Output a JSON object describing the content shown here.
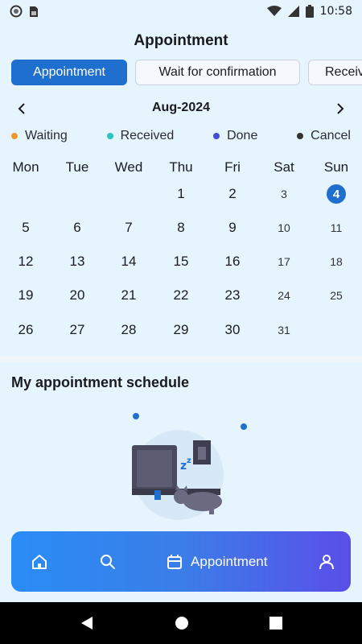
{
  "status_bar": {
    "time": "10:58"
  },
  "header": {
    "title": "Appointment"
  },
  "tabs": [
    {
      "label": "Appointment",
      "active": true
    },
    {
      "label": "Wait for confirmation",
      "active": false
    },
    {
      "label": "Receiv",
      "active": false
    }
  ],
  "calendar": {
    "month_label": "Aug-2024",
    "legend": [
      {
        "label": "Waiting",
        "color": "#f2962f"
      },
      {
        "label": "Received",
        "color": "#2bc4c4"
      },
      {
        "label": "Done",
        "color": "#4a4ad8"
      },
      {
        "label": "Cancel",
        "color": "#333333"
      }
    ],
    "weekdays": [
      "Mon",
      "Tue",
      "Wed",
      "Thu",
      "Fri",
      "Sat",
      "Sun"
    ],
    "weeks": [
      [
        "",
        "",
        "",
        "1",
        "2",
        "3",
        "4"
      ],
      [
        "5",
        "6",
        "7",
        "8",
        "9",
        "10",
        "11"
      ],
      [
        "12",
        "13",
        "14",
        "15",
        "16",
        "17",
        "18"
      ],
      [
        "19",
        "20",
        "21",
        "22",
        "23",
        "24",
        "25"
      ],
      [
        "26",
        "27",
        "28",
        "29",
        "30",
        "31",
        ""
      ]
    ],
    "today": "4",
    "accent_color": "#1f6fcf"
  },
  "schedule": {
    "title": "My appointment schedule"
  },
  "bottom_nav": {
    "items": [
      {
        "icon": "home-icon",
        "label": ""
      },
      {
        "icon": "search-icon",
        "label": ""
      },
      {
        "icon": "calendar-icon",
        "label": "Appointment",
        "active": true
      },
      {
        "icon": "user-icon",
        "label": ""
      }
    ]
  }
}
